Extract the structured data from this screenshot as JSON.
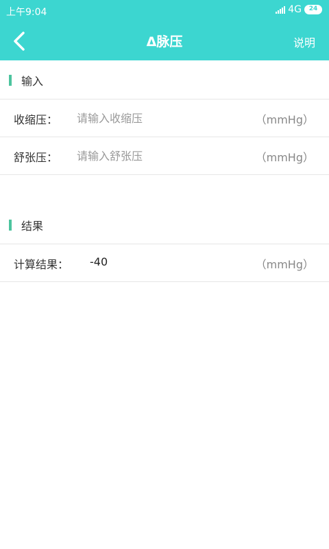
{
  "status_bar": {
    "time": "上午9:04",
    "network": "4G",
    "battery": "24"
  },
  "header": {
    "back_icon": "chevron-left-icon",
    "title": "Δ脉压",
    "help_label": "说明"
  },
  "input_section": {
    "title": "输入",
    "systolic": {
      "label": "收缩压：",
      "placeholder": "请输入收缩压",
      "value": "",
      "unit": "（mmHg）"
    },
    "diastolic": {
      "label": "舒张压：",
      "placeholder": "请输入舒张压",
      "value": "",
      "unit": "（mmHg）"
    }
  },
  "result_section": {
    "title": "结果",
    "result": {
      "label": "计算结果：",
      "value": "-40",
      "unit": "（mmHg）"
    }
  },
  "colors": {
    "primary": "#3cd6d0",
    "section_accent": "#4cc49e"
  }
}
